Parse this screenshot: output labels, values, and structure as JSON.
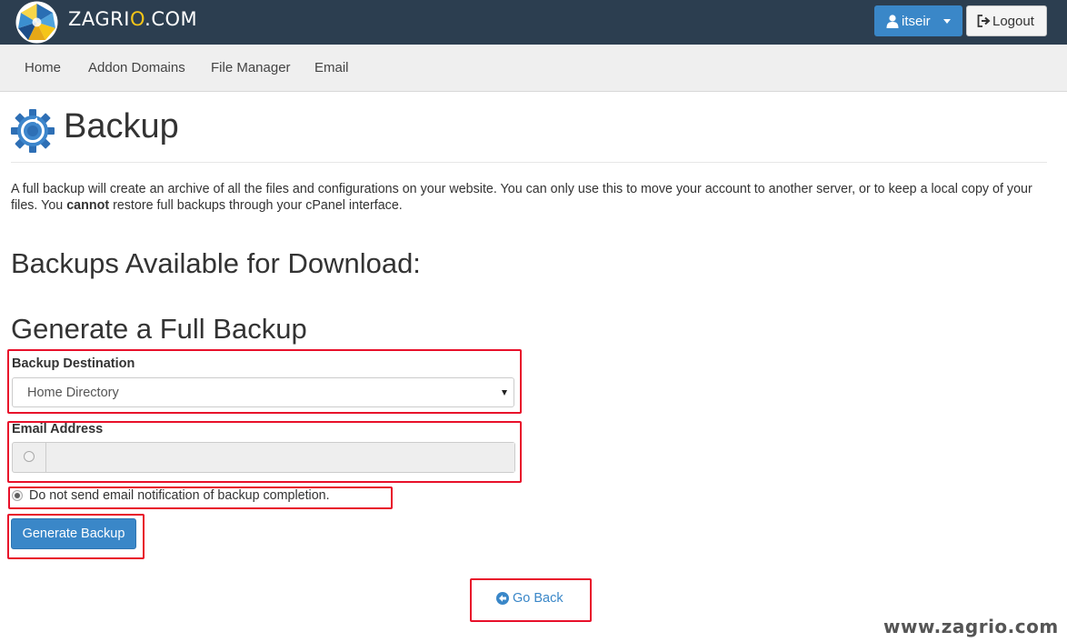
{
  "header": {
    "logo_text_pre": "ZAGRI",
    "logo_text_o": "O",
    "logo_text_post": ".COM",
    "user_label": "itseir",
    "logout_label": "Logout"
  },
  "nav": {
    "items": [
      {
        "label": "Home"
      },
      {
        "label": "Addon Domains"
      },
      {
        "label": "File Manager"
      },
      {
        "label": "Email"
      }
    ]
  },
  "page": {
    "title": "Backup",
    "intro_part1": "A full backup will create an archive of all the files and configurations on your website. You can only use this to move your account to another server, or to keep a local copy of your files. You ",
    "intro_bold": "cannot",
    "intro_part2": " restore full backups through your cPanel interface.",
    "available_heading": "Backups Available for Download:",
    "generate_heading": "Generate a Full Backup"
  },
  "form": {
    "destination_label": "Backup Destination",
    "destination_value": "Home Directory",
    "email_label": "Email Address",
    "email_value": "",
    "email_radio_selected": false,
    "no_email_label": "Do not send email notification of backup completion.",
    "no_email_radio_selected": true,
    "generate_button": "Generate Backup",
    "go_back_label": "Go Back"
  },
  "watermark": "www.zagrio.com",
  "colors": {
    "topbar": "#2c3e50",
    "primary": "#3a87c8",
    "highlight": "#e8102a",
    "logo_accent": "#f5c518"
  },
  "icons": [
    "logo-icon",
    "user-icon",
    "caret-down-icon",
    "logout-icon",
    "backup-gear-icon",
    "arrow-circle-left-icon"
  ]
}
